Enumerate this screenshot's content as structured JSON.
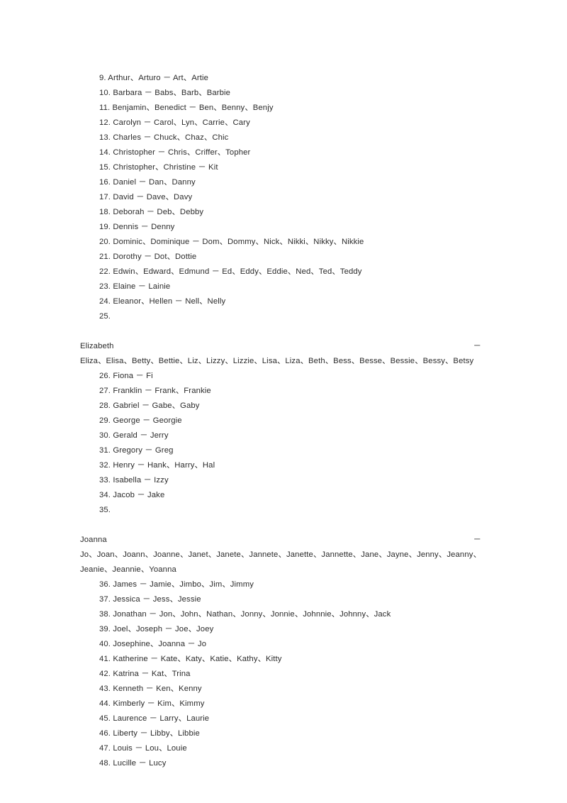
{
  "document": {
    "page_background": "#ffffff",
    "text_color": "#2b2b2b",
    "separator": "、",
    "dash": "-"
  },
  "entries": [
    {
      "number": "9.",
      "text": "9. Arthur、Arturo － Art、Artie",
      "style": "normal"
    },
    {
      "number": "10.",
      "text": "10. Barbara － Babs、Barb、Barbie",
      "style": "normal"
    },
    {
      "number": "11.",
      "text": "11. Benjamin、Benedict － Ben、Benny、Benjy",
      "style": "normal"
    },
    {
      "number": "12.",
      "text": "12. Carolyn － Carol、Lyn、Carrie、Cary",
      "style": "normal"
    },
    {
      "number": "13.",
      "text": "13. Charles － Chuck、Chaz、Chic",
      "style": "normal"
    },
    {
      "number": "14.",
      "text": "14. Christopher － Chris、Criffer、Topher",
      "style": "normal"
    },
    {
      "number": "15.",
      "text": "15. Christopher、Christine － Kit",
      "style": "normal"
    },
    {
      "number": "16.",
      "text": "16. Daniel － Dan、Danny",
      "style": "normal"
    },
    {
      "number": "17.",
      "text": "17. David － Dave、Davy",
      "style": "normal"
    },
    {
      "number": "18.",
      "text": "18. Deborah － Deb、Debby",
      "style": "normal"
    },
    {
      "number": "19.",
      "text": "19. Dennis － Denny",
      "style": "normal"
    },
    {
      "number": "20.",
      "text": "20. Dominic、Dominique － Dom、Dommy、Nick、Nikki、Nikky、Nikkie",
      "style": "normal"
    },
    {
      "number": "21.",
      "text": "21. Dorothy － Dot、Dottie",
      "style": "normal"
    },
    {
      "number": "22.",
      "text": "22. Edwin、Edward、Edmund － Ed、Eddy、Eddie、Ned、Ted、Teddy",
      "style": "normal"
    },
    {
      "number": "23.",
      "text": "23. Elaine － Lainie",
      "style": "normal"
    },
    {
      "number": "24.",
      "text": "24. Eleanor、Hellen － Nell、Nelly",
      "style": "normal"
    },
    {
      "number": "25.",
      "style": "justified",
      "head": "25.",
      "name": "Elizabeth －",
      "tail": "Eliza、Elisa、Betty、Bettie、Liz、Lizzy、Lizzie、Lisa、Liza、Beth、Bess、Besse、Bessie、Bessy、Betsy"
    },
    {
      "number": "26.",
      "text": "26. Fiona － Fi",
      "style": "normal"
    },
    {
      "number": "27.",
      "text": "27. Franklin － Frank、Frankie",
      "style": "normal"
    },
    {
      "number": "28.",
      "text": "28. Gabriel － Gabe、Gaby",
      "style": "normal"
    },
    {
      "number": "29.",
      "text": "29. George － Georgie",
      "style": "normal"
    },
    {
      "number": "30.",
      "text": "30. Gerald － Jerry",
      "style": "normal"
    },
    {
      "number": "31.",
      "text": "31. Gregory － Greg",
      "style": "normal"
    },
    {
      "number": "32.",
      "text": "32. Henry － Hank、Harry、Hal",
      "style": "normal"
    },
    {
      "number": "33.",
      "text": "33. Isabella － Izzy",
      "style": "normal"
    },
    {
      "number": "34.",
      "text": "34. Jacob － Jake",
      "style": "normal"
    },
    {
      "number": "35.",
      "style": "justified",
      "head": "35.",
      "name": "Joanna －",
      "tail": "Jo、Joan、Joann、Joanne、Janet、Janete、Jannete、Janette、Jannette、Jane、Jayne、Jenny、Jeanny、Jeanie、Jeannie、Yoanna"
    },
    {
      "number": "36.",
      "text": "36. James － Jamie、Jimbo、Jim、Jimmy",
      "style": "normal"
    },
    {
      "number": "37.",
      "text": "37. Jessica － Jess、Jessie",
      "style": "normal"
    },
    {
      "number": "38.",
      "text": "38. Jonathan － Jon、John、Nathan、Jonny、Jonnie、Johnnie、Johnny、Jack",
      "style": "normal"
    },
    {
      "number": "39.",
      "text": "39. Joel、Joseph － Joe、Joey",
      "style": "normal"
    },
    {
      "number": "40.",
      "text": "40. Josephine、Joanna － Jo",
      "style": "normal"
    },
    {
      "number": "41.",
      "text": "41. Katherine － Kate、Katy、Katie、Kathy、Kitty",
      "style": "normal"
    },
    {
      "number": "42.",
      "text": "42. Katrina － Kat、Trina",
      "style": "normal"
    },
    {
      "number": "43.",
      "text": "43. Kenneth － Ken、Kenny",
      "style": "normal"
    },
    {
      "number": "44.",
      "text": "44. Kimberly － Kim、Kimmy",
      "style": "normal"
    },
    {
      "number": "45.",
      "text": "45. Laurence － Larry、Laurie",
      "style": "normal"
    },
    {
      "number": "46.",
      "text": "46. Liberty － Libby、Libbie",
      "style": "normal"
    },
    {
      "number": "47.",
      "text": "47. Louis － Lou、Louie",
      "style": "normal"
    },
    {
      "number": "48.",
      "text": "48. Lucille － Lucy",
      "style": "normal"
    }
  ]
}
